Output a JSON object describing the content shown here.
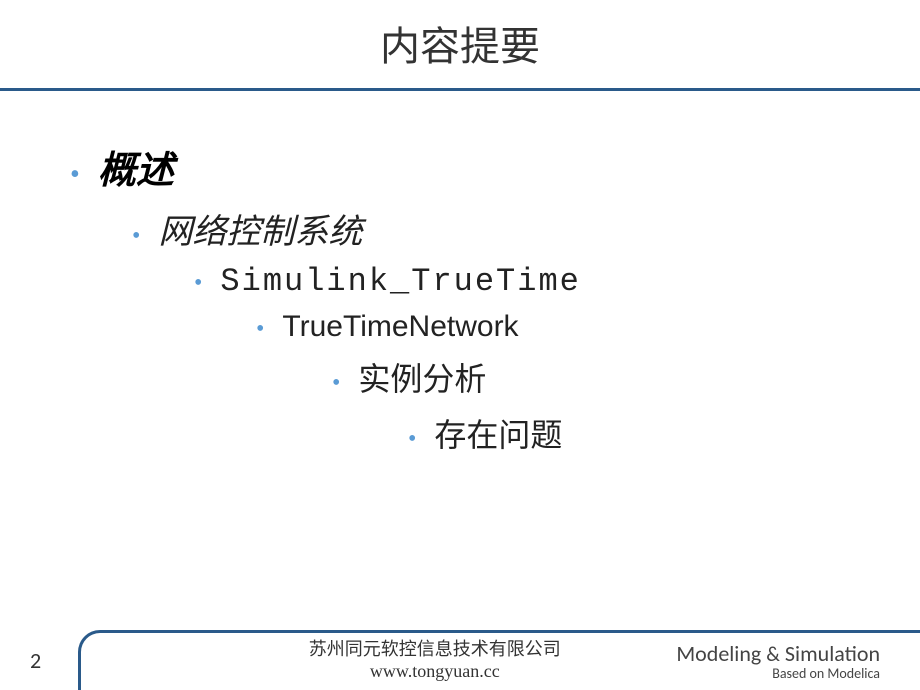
{
  "title": "内容提要",
  "outline": {
    "l1": "概述",
    "l2": "网络控制系统",
    "l3": "Simulink_TrueTime",
    "l4": "TrueTimeNetwork",
    "l5": "实例分析",
    "l6": "存在问题"
  },
  "footer": {
    "page": "2",
    "company": "苏州同元软控信息技术有限公司",
    "url": "www.tongyuan.cc",
    "brand_a": "Modeling",
    "brand_amp": "&",
    "brand_b": "Simulation",
    "subtitle": "Based on Modelica"
  }
}
